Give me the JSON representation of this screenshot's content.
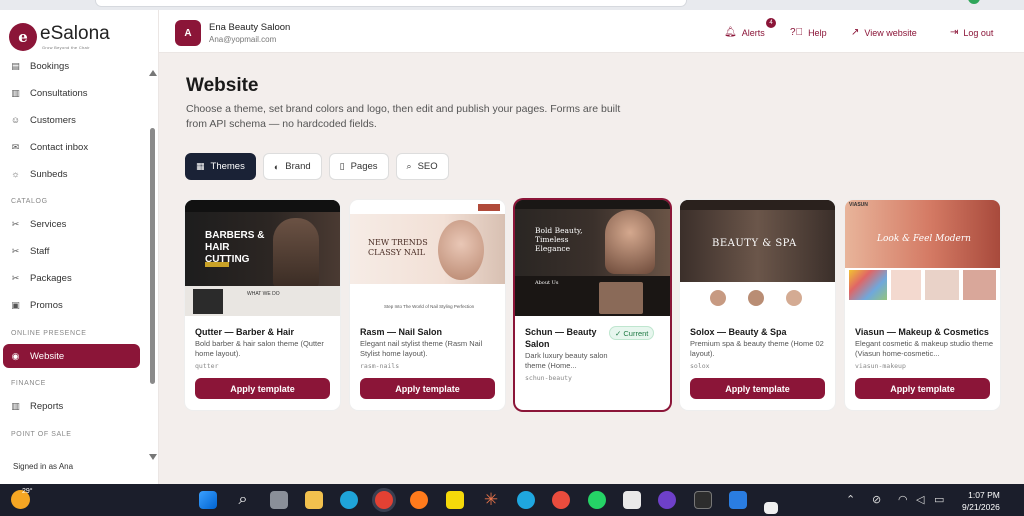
{
  "app": {
    "name": "eSalona",
    "tagline": "Grow Beyond the Chair"
  },
  "sidebar": {
    "items": [
      {
        "label": "Bookings",
        "icon": "calendar-icon"
      },
      {
        "label": "Consultations",
        "icon": "clipboard-icon"
      },
      {
        "label": "Customers",
        "icon": "users-icon"
      },
      {
        "label": "Contact inbox",
        "icon": "mail-icon"
      },
      {
        "label": "Sunbeds",
        "icon": "sun-icon"
      }
    ],
    "catalog_label": "CATALOG",
    "catalog": [
      {
        "label": "Services",
        "icon": "scissors-icon"
      },
      {
        "label": "Staff",
        "icon": "user-icon"
      },
      {
        "label": "Packages",
        "icon": "package-icon"
      },
      {
        "label": "Promos",
        "icon": "tag-icon"
      }
    ],
    "online_label": "ONLINE PRESENCE",
    "website": {
      "label": "Website",
      "icon": "globe-icon"
    },
    "finance_label": "FINANCE",
    "reports": {
      "label": "Reports",
      "icon": "bar-chart-icon"
    },
    "pos_label": "POINT OF SALE",
    "signed_in_prefix": "Signed in as",
    "signed_in_user": "Ana"
  },
  "topbar": {
    "avatar_initial": "A",
    "org_name": "Ena Beauty Saloon",
    "email": "Ana@yopmail.com",
    "alerts_label": "Alerts",
    "alerts_count": "4",
    "help_label": "Help",
    "view_website_label": "View website",
    "logout_label": "Log out"
  },
  "page": {
    "title": "Website",
    "description": "Choose a theme, set brand colors and logo, then edit and publish your pages. Forms are built from API schema — no hardcoded fields."
  },
  "tabs": [
    {
      "label": "Themes",
      "icon": "layout-icon",
      "active": true
    },
    {
      "label": "Brand",
      "icon": "palette-icon",
      "active": false
    },
    {
      "label": "Pages",
      "icon": "file-icon",
      "active": false
    },
    {
      "label": "SEO",
      "icon": "search-icon",
      "active": false
    }
  ],
  "templates": [
    {
      "title": "Qutter — Barber & Hair",
      "desc": "Bold barber & hair salon theme (Qutter home layout).",
      "slug": "qutter",
      "button": "Apply template",
      "current": false,
      "thumb_text": "BARBERS & HAIR CUTTING",
      "thumb_sub": "WHAT WE DO"
    },
    {
      "title": "Rasm — Nail Salon",
      "desc": "Elegant nail stylist theme (Rasm Nail Stylist home layout).",
      "slug": "rasm-nails",
      "button": "Apply template",
      "current": false,
      "thumb_text": "NEW TRENDS CLASSY NAIL",
      "thumb_sub": "Step Into The World of Nail Styling Perfection"
    },
    {
      "title": "Schun — Beauty Salon",
      "desc": "Dark luxury beauty salon theme (Home...",
      "slug": "schun-beauty",
      "button": "Apply template",
      "current": true,
      "current_label": "Current",
      "thumb_text": "Bold Beauty, Timeless Elegance",
      "thumb_sub": "About Us"
    },
    {
      "title": "Solox — Beauty & Spa",
      "desc": "Premium spa & beauty theme (Home 02 layout).",
      "slug": "solox",
      "button": "Apply template",
      "current": false,
      "thumb_text": "BEAUTY & SPA"
    },
    {
      "title": "Viasun — Makeup & Cosmetics",
      "desc": "Elegant cosmetic & makeup studio theme (Viasun home-cosmetic...",
      "slug": "viasun-makeup",
      "button": "Apply template",
      "current": false,
      "thumb_text": "Look & Feel Modern",
      "thumb_sub": "VIASUN"
    }
  ],
  "taskbar": {
    "temp": "29°",
    "time": "1:07 PM",
    "date": "9/21/2026"
  },
  "colors": {
    "brand": "#8b1538",
    "dark": "#1a2236"
  }
}
